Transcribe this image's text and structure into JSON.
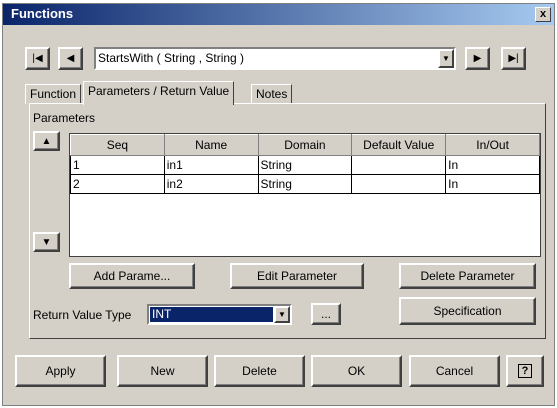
{
  "window": {
    "title": "Functions",
    "close_label": "x"
  },
  "navigation": {
    "first": "|◀",
    "prev": "◀",
    "next": "▶",
    "last": "▶|",
    "selected_function": "StartsWith ( String , String  )"
  },
  "tabs": [
    {
      "label": "Function"
    },
    {
      "label": "Parameters / Return Value"
    },
    {
      "label": "Notes"
    }
  ],
  "parameters": {
    "group_label": "Parameters",
    "columns": [
      "Seq",
      "Name",
      "Domain",
      "Default Value",
      "In/Out"
    ],
    "rows": [
      [
        "1",
        "in1",
        "String",
        "",
        "In"
      ],
      [
        "2",
        "in2",
        "String",
        "",
        "In"
      ]
    ],
    "up_label": "▲",
    "down_label": "▼"
  },
  "buttons": {
    "add_parameter": "Add Parame...",
    "edit_parameter": "Edit Parameter",
    "delete_parameter": "Delete Parameter",
    "specification": "Specification",
    "ellipsis": "...",
    "apply": "Apply",
    "new": "New",
    "delete": "Delete",
    "ok": "OK",
    "cancel": "Cancel",
    "help": "?"
  },
  "return_value": {
    "label": "Return Value Type",
    "value": "INT"
  },
  "colors": {
    "title_start": "#0a246a",
    "title_end": "#a6caf0",
    "selection": "#0a246a",
    "face": "#d4d0c8"
  }
}
